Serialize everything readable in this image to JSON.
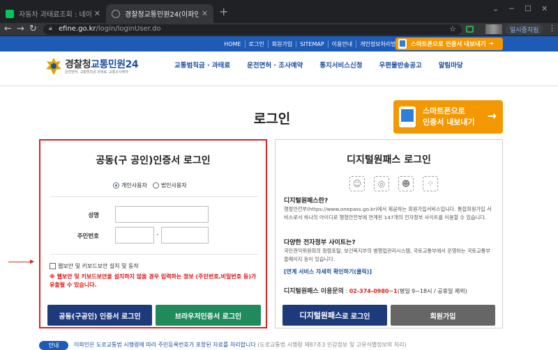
{
  "browser": {
    "tabs": [
      {
        "title": "자동차 과태료조회 : 네이버 통합검색",
        "active": false
      },
      {
        "title": "경찰청교통민원24(이파인)",
        "active": true
      }
    ],
    "new_tab": "+",
    "url_domain": "efine.go.kr",
    "url_path": "/login/loginUser.do",
    "pause_label": "일시중지됨",
    "window_controls": {
      "minimize": "─",
      "maximize": "☐",
      "close": "✕"
    }
  },
  "site": {
    "topnav": [
      "HOME",
      "로그인",
      "회원가입",
      "SITEMAP",
      "이용안내",
      "개인정보처리방침"
    ],
    "smart_button": "스마트폰으로 인증서 내보내기",
    "logo": {
      "title_main": "경찰청",
      "title_accent": "교통민원24",
      "subtitle": "운전면허, 교통범칙금·과태료, 교통조사예약"
    },
    "menu": [
      "교통범칙금 · 과태료",
      "운전면허 · 조사예약",
      "통지서비스신청",
      "우편물반송공고",
      "알림마당"
    ],
    "page_title": "로그인",
    "smart_big": {
      "line1": "스마트폰으로",
      "line2": "인증서 내보내기",
      "arrow": "→"
    }
  },
  "cert_login": {
    "title": "공동(구 공인)인증서 로그인",
    "radio_personal": "개인사용자",
    "radio_corporate": "법인사용자",
    "name_label": "성명",
    "rrn_label": "주민번호",
    "rrn_dash": "-",
    "security_check": "웹보안 및 키보드보안 설치 및 동작",
    "warning": "※ 웹보안 및 키보드보안을 설치하지 않을 경우 입력하는 정보 (주민번호,비밀번호 등)가 유출될 수 있습니다.",
    "btn_cert": "공동(구공인) 인증서 로그인",
    "btn_browser": "브라우저인증서 로그인"
  },
  "digital_pass": {
    "title": "디지털원패스 로그인",
    "q1": "디지털원패스란?",
    "a1": "행정안전부(https://www.onepass.go.kr)에서 제공하는 회원가입서비스입니다. 통합회원가입 서비스로서 하나의 아이디로 행정안전부에 연계된 147개의 전자정부 사이트를 이용할 수 있습니다.",
    "q2": "다양한 전자정부 사이트는?",
    "a2": "국민권익위원회의 청렴포털, 보건복지부의 병행업관리시스템, 국토교통부에서 운영하는 국토교통부홈페이지 등이 있습니다.",
    "link": "[연계 서비스 자세히 확인하기(클릭)]",
    "inquiry_label": "디지털원패스 이용문의",
    "inquiry_phone": "02-374-0980~1",
    "inquiry_hours": "(평일 9~18시 / 공휴일 제외)",
    "btn_login_strong": "디지털원패스",
    "btn_login_rest": " 로 로그인",
    "btn_signup": "회원가입",
    "icons": [
      "face-scan-icon",
      "fingerprint-icon",
      "face-id-icon",
      "pattern-icon"
    ]
  },
  "notice": {
    "badge": "안내",
    "text": "이파인은 도로교통법 시행령에 따라 주민등록번호가 포함된 자료를 처리합니다",
    "text2": "(도로교통법 시행령 제87조3 민감정보 및 고유식별정보의 처리)"
  },
  "colors": {
    "primary": "#1e5bb7",
    "orange": "#f39800",
    "red_highlight": "#e02020",
    "navy_button": "#1d3a7a",
    "green_button": "#1f8a5c",
    "gray_button": "#666666"
  }
}
